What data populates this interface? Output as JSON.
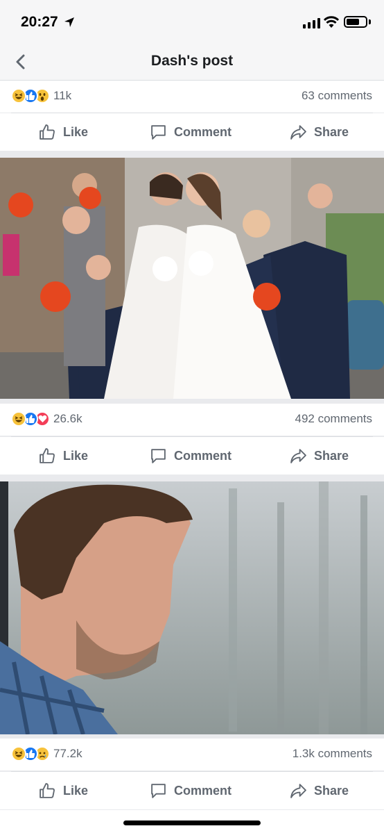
{
  "status_bar": {
    "time": "20:27"
  },
  "nav": {
    "title": "Dash's post"
  },
  "posts": [
    {
      "reaction_count": "11k",
      "comments": "63 comments",
      "reactions": [
        "haha",
        "like",
        "wow"
      ]
    },
    {
      "reaction_count": "26.6k",
      "comments": "492 comments",
      "reactions": [
        "haha",
        "like",
        "love"
      ]
    },
    {
      "reaction_count": "77.2k",
      "comments": "1.3k comments",
      "reactions": [
        "haha",
        "like",
        "sad"
      ]
    }
  ],
  "actions": {
    "like": "Like",
    "comment": "Comment",
    "share": "Share"
  },
  "colors": {
    "like_blue": "#1877f2",
    "love_red": "#f33e58",
    "reaction_yellow": "#f7c23b",
    "meta_gray": "#606770"
  }
}
